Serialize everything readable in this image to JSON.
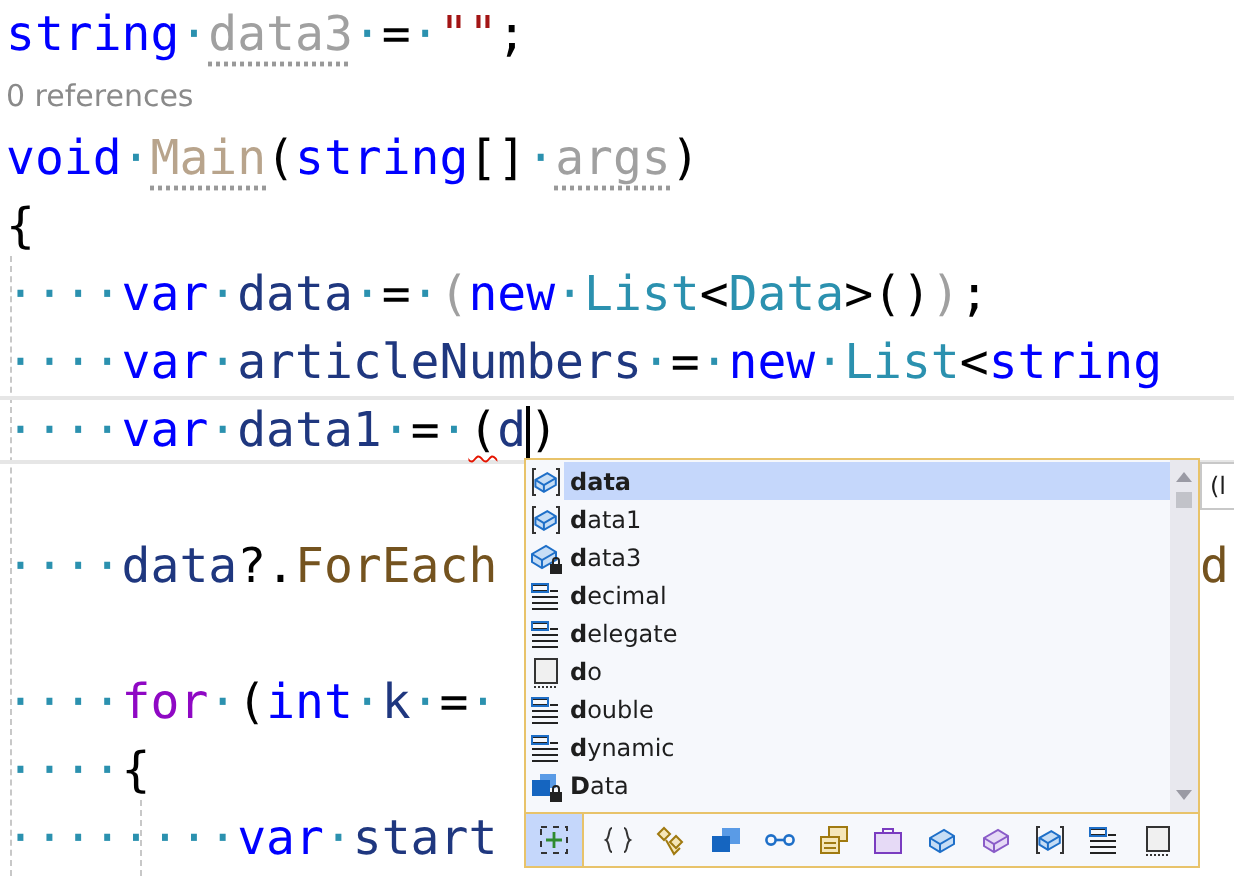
{
  "code_lines": [
    {
      "kind": "code",
      "tokens": [
        {
          "t": "string",
          "kind": "kw"
        },
        {
          "t": "·",
          "kind": "ws"
        },
        {
          "t": "data3",
          "kind": "unused",
          "hint": true
        },
        {
          "t": "·",
          "kind": "ws"
        },
        {
          "t": "=",
          "kind": "plain"
        },
        {
          "t": "·",
          "kind": "ws"
        },
        {
          "t": "\"\"",
          "kind": "str"
        },
        {
          "t": ";",
          "kind": "plain"
        }
      ]
    },
    {
      "kind": "lens",
      "text": "0 references"
    },
    {
      "kind": "code",
      "tokens": [
        {
          "t": "void",
          "kind": "kw"
        },
        {
          "t": "·",
          "kind": "ws"
        },
        {
          "t": "Main",
          "kind": "unusedm",
          "hint": true
        },
        {
          "t": "(",
          "kind": "plain"
        },
        {
          "t": "string",
          "kind": "kw"
        },
        {
          "t": "[]",
          "kind": "plain"
        },
        {
          "t": "·",
          "kind": "ws"
        },
        {
          "t": "args",
          "kind": "unused",
          "hint": true
        },
        {
          "t": ")",
          "kind": "plain"
        }
      ]
    },
    {
      "kind": "code",
      "tokens": [
        {
          "t": "{",
          "kind": "plain"
        }
      ]
    },
    {
      "kind": "code",
      "tokens": [
        {
          "t": "····",
          "kind": "ws"
        },
        {
          "t": "var",
          "kind": "kw"
        },
        {
          "t": "·",
          "kind": "ws"
        },
        {
          "t": "data",
          "kind": "id"
        },
        {
          "t": "·",
          "kind": "ws"
        },
        {
          "t": "=",
          "kind": "plain"
        },
        {
          "t": "·",
          "kind": "ws"
        },
        {
          "t": "(",
          "kind": "dim"
        },
        {
          "t": "new",
          "kind": "kw"
        },
        {
          "t": "·",
          "kind": "ws"
        },
        {
          "t": "List",
          "kind": "type"
        },
        {
          "t": "<",
          "kind": "plain"
        },
        {
          "t": "Data",
          "kind": "type"
        },
        {
          "t": ">()",
          "kind": "plain"
        },
        {
          "t": ")",
          "kind": "dim"
        },
        {
          "t": ";",
          "kind": "plain"
        }
      ]
    },
    {
      "kind": "code",
      "tokens": [
        {
          "t": "····",
          "kind": "ws"
        },
        {
          "t": "var",
          "kind": "kw"
        },
        {
          "t": "·",
          "kind": "ws"
        },
        {
          "t": "articleNumbers",
          "kind": "id"
        },
        {
          "t": "·",
          "kind": "ws"
        },
        {
          "t": "=",
          "kind": "plain"
        },
        {
          "t": "·",
          "kind": "ws"
        },
        {
          "t": "new",
          "kind": "kw"
        },
        {
          "t": "·",
          "kind": "ws"
        },
        {
          "t": "List",
          "kind": "type"
        },
        {
          "t": "<",
          "kind": "plain"
        },
        {
          "t": "string",
          "kind": "kw"
        }
      ]
    },
    {
      "kind": "code",
      "current": true,
      "tokens": [
        {
          "t": "····",
          "kind": "ws"
        },
        {
          "t": "var",
          "kind": "kw"
        },
        {
          "t": "·",
          "kind": "ws"
        },
        {
          "t": "data1",
          "kind": "id"
        },
        {
          "t": "·",
          "kind": "ws"
        },
        {
          "t": "=",
          "kind": "plain"
        },
        {
          "t": "·",
          "kind": "ws"
        },
        {
          "t": "(",
          "kind": "plain",
          "error": true
        },
        {
          "t": "d",
          "kind": "id",
          "caret": true
        },
        {
          "t": ")",
          "kind": "plain"
        }
      ]
    },
    {
      "kind": "blank"
    },
    {
      "kind": "code",
      "tail": "d",
      "tokens": [
        {
          "t": "····",
          "kind": "ws"
        },
        {
          "t": "data",
          "kind": "id"
        },
        {
          "t": "?.",
          "kind": "plain"
        },
        {
          "t": "ForEach",
          "kind": "method"
        }
      ]
    },
    {
      "kind": "blank"
    },
    {
      "kind": "code",
      "tokens": [
        {
          "t": "····",
          "kind": "ws"
        },
        {
          "t": "for",
          "kind": "ctl"
        },
        {
          "t": "·",
          "kind": "ws"
        },
        {
          "t": "(",
          "kind": "plain"
        },
        {
          "t": "int",
          "kind": "kw"
        },
        {
          "t": "·",
          "kind": "ws"
        },
        {
          "t": "k",
          "kind": "id"
        },
        {
          "t": "·",
          "kind": "ws"
        },
        {
          "t": "=",
          "kind": "plain"
        },
        {
          "t": "·",
          "kind": "ws"
        }
      ]
    },
    {
      "kind": "code",
      "tokens": [
        {
          "t": "····",
          "kind": "ws"
        },
        {
          "t": "{",
          "kind": "plain"
        }
      ]
    },
    {
      "kind": "code",
      "tokens": [
        {
          "t": "········",
          "kind": "ws"
        },
        {
          "t": "var",
          "kind": "kw"
        },
        {
          "t": "·",
          "kind": "ws"
        },
        {
          "t": "start",
          "kind": "id"
        }
      ]
    }
  ],
  "completion": {
    "items": [
      {
        "label": "data",
        "kind": "local",
        "selected": true
      },
      {
        "label": "**d**ata1",
        "kind": "local",
        "selected": false
      },
      {
        "label": "**d**ata3",
        "kind": "field-lock",
        "selected": false
      },
      {
        "label": "**d**ecimal",
        "kind": "keyword-type",
        "selected": false
      },
      {
        "label": "**d**elegate",
        "kind": "keyword-type",
        "selected": false
      },
      {
        "label": "**d**o",
        "kind": "keyword",
        "selected": false
      },
      {
        "label": "**d**ouble",
        "kind": "keyword-type",
        "selected": false
      },
      {
        "label": "**d**ynamic",
        "kind": "keyword-type",
        "selected": false
      },
      {
        "label": "**D**ata",
        "kind": "class-lock",
        "selected": false
      }
    ],
    "filters": [
      {
        "kind": "expand",
        "selected": true
      },
      {
        "kind": "braces",
        "selected": false
      },
      {
        "kind": "namespace",
        "selected": false
      },
      {
        "kind": "class",
        "selected": false
      },
      {
        "kind": "interface",
        "selected": false
      },
      {
        "kind": "struct",
        "selected": false
      },
      {
        "kind": "module",
        "selected": false
      },
      {
        "kind": "field",
        "selected": false
      },
      {
        "kind": "property",
        "selected": false
      },
      {
        "kind": "local",
        "selected": false
      },
      {
        "kind": "keyword-type",
        "selected": false
      },
      {
        "kind": "keyword",
        "selected": false
      }
    ]
  },
  "tooltip": {
    "text": "(l"
  }
}
